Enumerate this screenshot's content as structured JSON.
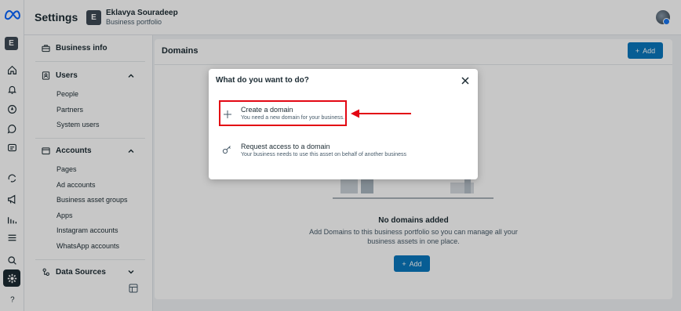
{
  "topbar": {
    "title": "Settings",
    "business_initial": "E",
    "business_name": "Eklavya Souradeep",
    "business_subtitle": "Business portfolio"
  },
  "rail": {
    "avatar_initial": "E",
    "icons": [
      "home-icon",
      "bell-icon",
      "compass-icon",
      "chat-icon",
      "pages-icon",
      "campaign-icon",
      "megaphone-icon",
      "insights-icon",
      "menu-icon",
      "search-icon",
      "settings-icon",
      "help-icon"
    ]
  },
  "sidebar": {
    "business_info": "Business info",
    "users_header": "Users",
    "users_items": [
      "People",
      "Partners",
      "System users"
    ],
    "accounts_header": "Accounts",
    "accounts_items": [
      "Pages",
      "Ad accounts",
      "Business asset groups",
      "Apps",
      "Instagram accounts",
      "WhatsApp accounts"
    ],
    "data_sources_header": "Data Sources"
  },
  "main": {
    "header": "Domains",
    "add_label": "Add",
    "empty_title": "No domains added",
    "empty_desc": "Add Domains to this business portfolio so you can manage all your business assets in one place.",
    "empty_add_label": "Add"
  },
  "modal": {
    "title": "What do you want to do?",
    "options": [
      {
        "title": "Create a domain",
        "desc": "You need a new domain for your business."
      },
      {
        "title": "Request access to a domain",
        "desc": "Your business needs to use this asset on behalf of another business"
      }
    ]
  },
  "colors": {
    "accent": "#0a78be",
    "annotation": "#e30613",
    "text_primary": "#1c2b33",
    "background": "#f0f2f5"
  }
}
